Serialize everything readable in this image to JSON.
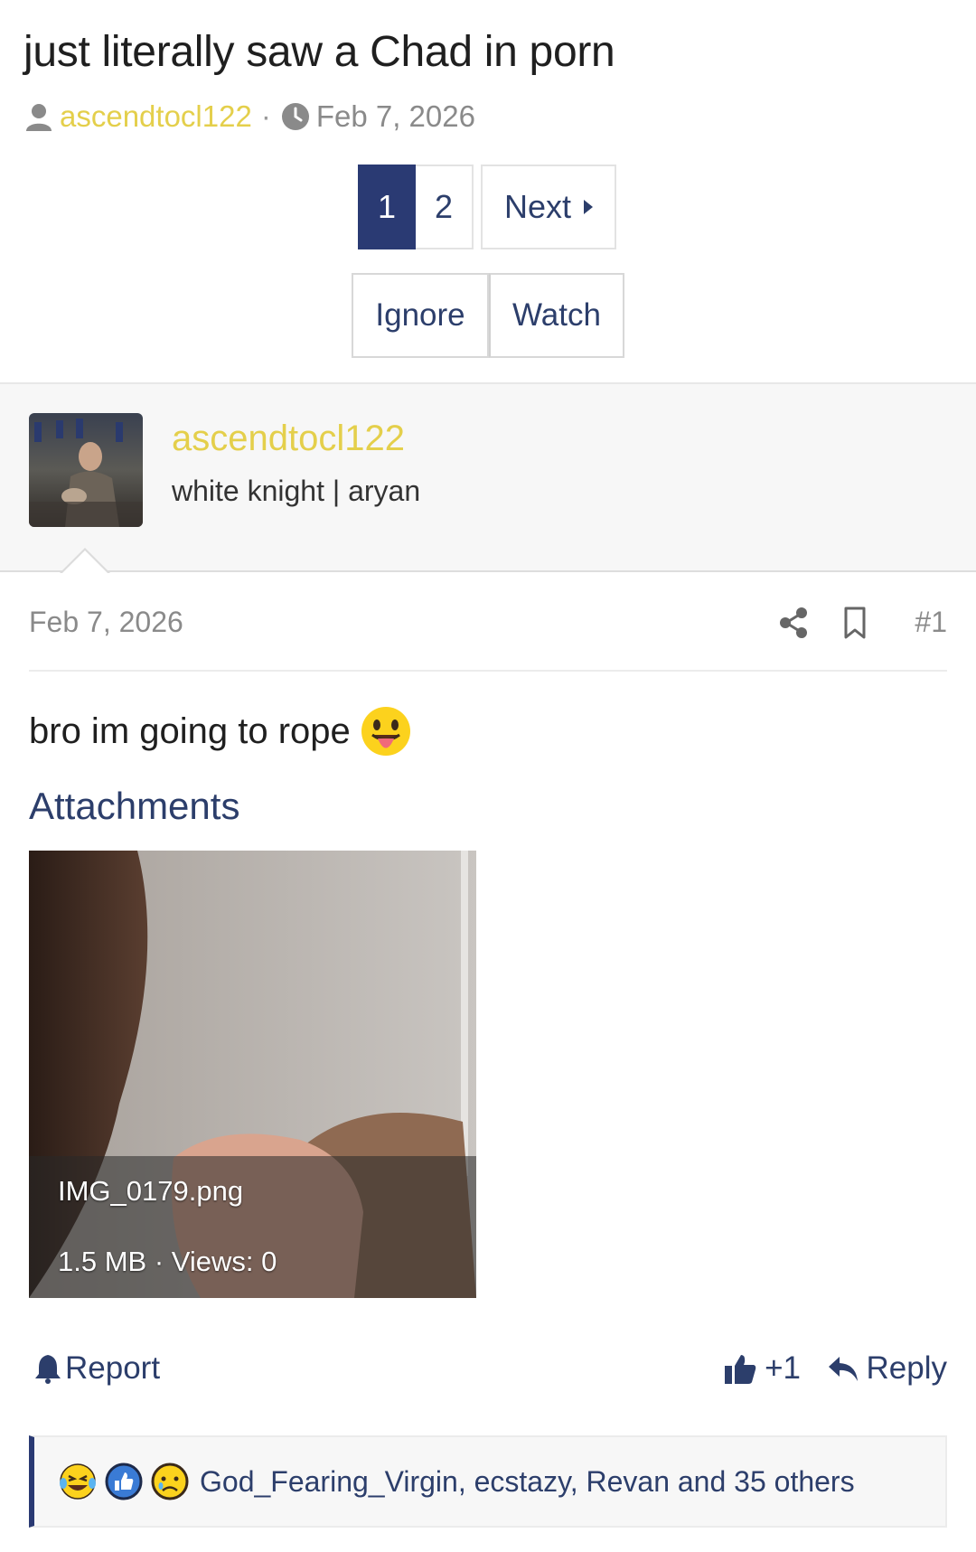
{
  "thread": {
    "title": "just literally saw a Chad in porn",
    "author": "ascendtocl122",
    "separator": "·",
    "date": "Feb 7, 2026"
  },
  "pagination": {
    "pages": [
      "1",
      "2"
    ],
    "current": "1",
    "next_label": "Next"
  },
  "thread_actions": {
    "ignore_label": "Ignore",
    "watch_label": "Watch"
  },
  "post": {
    "username": "ascendtocl122",
    "user_title": "white knight | aryan",
    "date": "Feb 7, 2026",
    "number": "#1",
    "body": "bro im going to rope",
    "body_emoji": "tongue-out-emoji",
    "attachments_heading": "Attachments",
    "attachment": {
      "filename": "IMG_0179.png",
      "info": "1.5 MB · Views: 0"
    },
    "report_label": "Report",
    "like_count": "+1",
    "reply_label": "Reply",
    "reactions": {
      "icons": [
        "laugh-cry-emoji",
        "like-emoji",
        "sad-emoji"
      ],
      "users": "God_Fearing_Virgin, ecstazy, Revan and 35 others"
    }
  },
  "colors": {
    "accent": "#2a3a73",
    "link": "#2c3e6b",
    "username": "#e4cf4b",
    "muted": "#8a8a8a"
  }
}
